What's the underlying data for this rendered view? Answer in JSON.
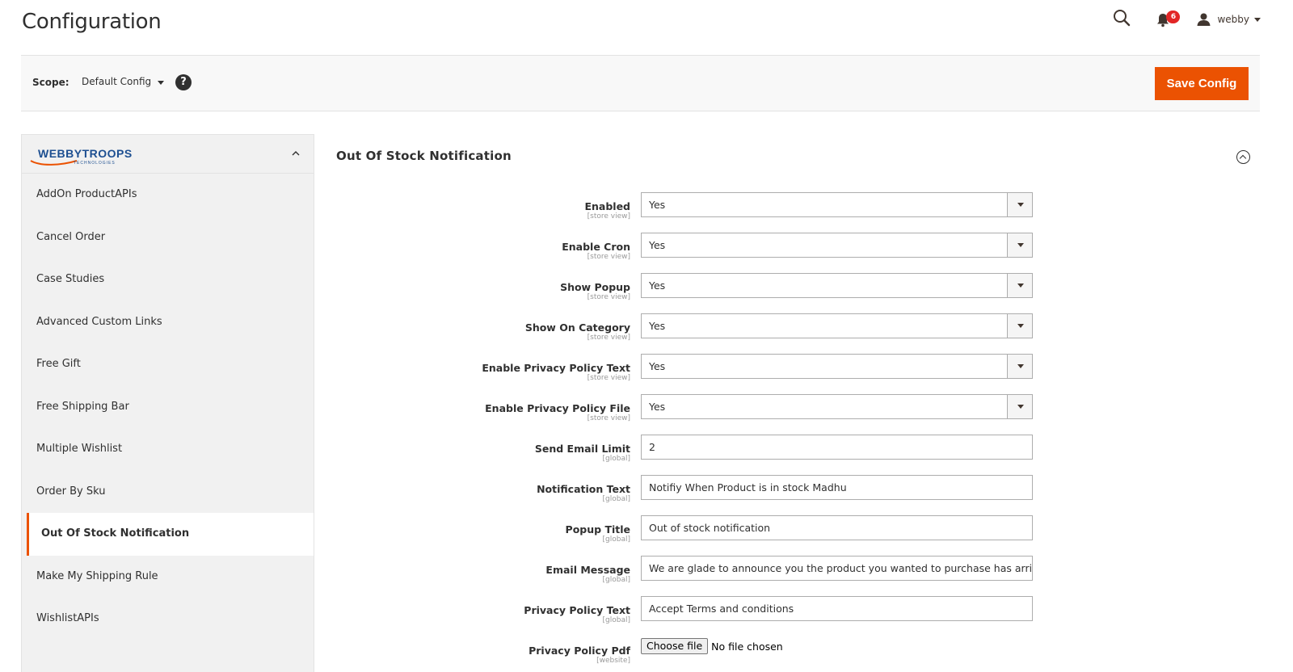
{
  "header": {
    "title": "Configuration",
    "notifications_count": "6",
    "username": "webby"
  },
  "scope": {
    "label": "Scope:",
    "value": "Default Config",
    "help": "?"
  },
  "toolbar": {
    "save_label": "Save Config"
  },
  "sidebar": {
    "brand": "WEBBYTROOPS",
    "brand_sub": "TECHNOLOGIES",
    "items": [
      {
        "label": "AddOn ProductAPIs"
      },
      {
        "label": "Cancel Order"
      },
      {
        "label": "Case Studies"
      },
      {
        "label": "Advanced Custom Links"
      },
      {
        "label": "Free Gift"
      },
      {
        "label": "Free Shipping Bar"
      },
      {
        "label": "Multiple Wishlist"
      },
      {
        "label": "Order By Sku"
      },
      {
        "label": "Out Of Stock Notification"
      },
      {
        "label": "Make My Shipping Rule"
      },
      {
        "label": "WishlistAPIs"
      }
    ],
    "active_index": 8
  },
  "section": {
    "title": "Out Of Stock Notification"
  },
  "fields": [
    {
      "label": "Enabled",
      "scope": "[store view]",
      "value": "Yes",
      "type": "select"
    },
    {
      "label": "Enable Cron",
      "scope": "[store view]",
      "value": "Yes",
      "type": "select"
    },
    {
      "label": "Show Popup",
      "scope": "[store view]",
      "value": "Yes",
      "type": "select"
    },
    {
      "label": "Show On Category",
      "scope": "[store view]",
      "value": "Yes",
      "type": "select"
    },
    {
      "label": "Enable Privacy Policy Text",
      "scope": "[store view]",
      "value": "Yes",
      "type": "select"
    },
    {
      "label": "Enable Privacy Policy File",
      "scope": "[store view]",
      "value": "Yes",
      "type": "select"
    },
    {
      "label": "Send Email Limit",
      "scope": "[global]",
      "value": "2",
      "type": "text"
    },
    {
      "label": "Notification Text",
      "scope": "[global]",
      "value": "Notifiy When Product is in stock Madhu",
      "type": "text"
    },
    {
      "label": "Popup Title",
      "scope": "[global]",
      "value": "Out of stock notification",
      "type": "text"
    },
    {
      "label": "Email Message",
      "scope": "[global]",
      "value": "We are glade to announce you the product you wanted to purchase has arrived",
      "type": "text"
    },
    {
      "label": "Privacy Policy Text",
      "scope": "[global]",
      "value": "Accept Terms and conditions",
      "type": "text"
    },
    {
      "label": "Privacy Policy Pdf",
      "scope": "[website]",
      "button": "Choose file",
      "value": "No file chosen",
      "type": "file"
    }
  ],
  "colors": {
    "accent": "#eb5202",
    "badge": "#e22626",
    "sidebar_bg": "#f1f1f1",
    "brand_blue": "#1d4f91"
  }
}
